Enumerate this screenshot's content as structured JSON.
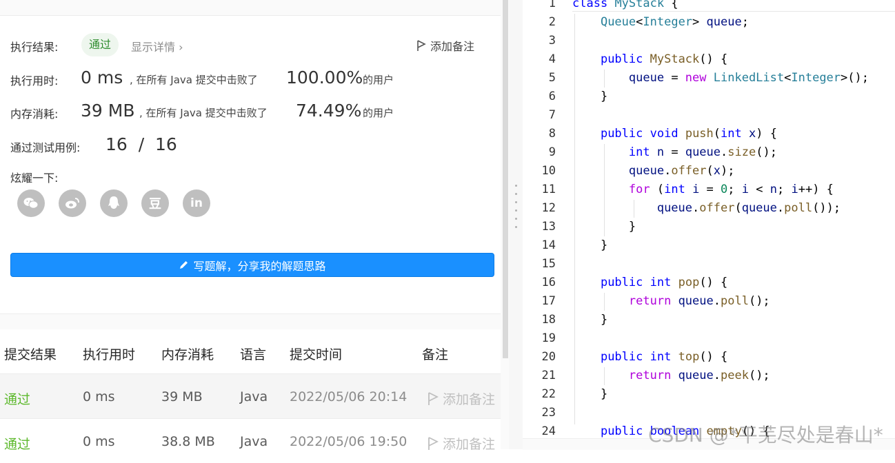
{
  "result": {
    "label_status": "执行结果:",
    "status": "通过",
    "details": "显示详情",
    "add_note": "添加备注",
    "label_time": "执行用时:",
    "time_value": "0 ms",
    "time_mid": ", 在所有 Java 提交中击败了",
    "time_pct": "100.00%",
    "time_tail": "的用户",
    "label_mem": "内存消耗:",
    "mem_value": "39 MB",
    "mem_mid": ", 在所有 Java 提交中击败了",
    "mem_pct": "74.49%",
    "mem_tail": "的用户",
    "label_tests": "通过测试用例:",
    "tests_value": "16  /  16",
    "label_share": "炫耀一下:",
    "share_icons": [
      "wechat-icon",
      "weibo-icon",
      "qq-icon",
      "douban-icon",
      "linkedin-icon"
    ],
    "douban_glyph": "豆",
    "linkedin_glyph": "in",
    "solution_button": "写题解，分享我的解题思路"
  },
  "table": {
    "headers": [
      "提交结果",
      "执行用时",
      "内存消耗",
      "语言",
      "提交时间",
      "备注"
    ],
    "rows": [
      {
        "status": "通过",
        "time": "0 ms",
        "memory": "39 MB",
        "lang": "Java",
        "date": "2022/05/06 20:14",
        "note": "添加备注"
      },
      {
        "status": "通过",
        "time": "0 ms",
        "memory": "38.8 MB",
        "lang": "Java",
        "date": "2022/05/06 19:50",
        "note": "添加备注"
      }
    ]
  },
  "editor": {
    "line_numbers": [
      "1",
      "2",
      "3",
      "4",
      "5",
      "6",
      "7",
      "8",
      "9",
      "10",
      "11",
      "12",
      "13",
      "14",
      "15",
      "16",
      "17",
      "18",
      "19",
      "20",
      "21",
      "22",
      "23",
      "24"
    ]
  },
  "watermark": "CSDN @*平芜尽处是春山*",
  "colors": {
    "accent": "#1a90ff",
    "pass_green": "#5cb82b",
    "keyword_blue": "#0000ff",
    "keyword_purple": "#af00db",
    "type_teal": "#267f99",
    "func_brown": "#795e26"
  }
}
